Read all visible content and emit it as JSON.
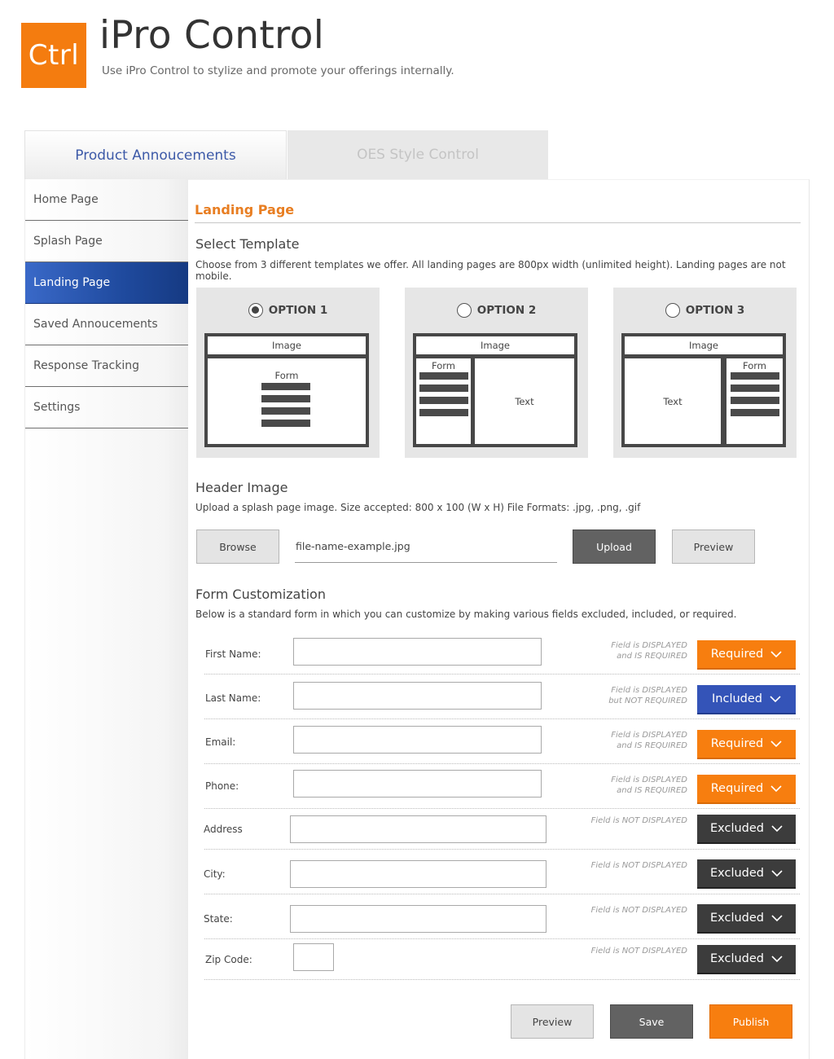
{
  "app": {
    "logo_text": "Ctrl",
    "title": "iPro Control",
    "subtitle": "Use iPro Control to stylize and promote your offerings internally."
  },
  "tabs": [
    {
      "label": "Product Annoucements",
      "active": true
    },
    {
      "label": "OES Style Control",
      "active": false
    }
  ],
  "sidebar": {
    "items": [
      {
        "label": "Home Page"
      },
      {
        "label": "Splash Page"
      },
      {
        "label": "Landing Page",
        "active": true
      },
      {
        "label": "Saved Annoucements"
      },
      {
        "label": "Response Tracking"
      },
      {
        "label": "Settings"
      }
    ]
  },
  "main": {
    "section_title": "Landing Page",
    "template": {
      "heading": "Select Template",
      "description": "Choose from 3 different templates we offer.  All landing pages are 800px width (unlimited height).   Landing pages are not mobile.",
      "options": [
        {
          "label": "OPTION 1",
          "selected": true,
          "image": "Image",
          "form": "Form"
        },
        {
          "label": "OPTION 2",
          "selected": false,
          "image": "Image",
          "form": "Form",
          "text": "Text"
        },
        {
          "label": "OPTION 3",
          "selected": false,
          "image": "Image",
          "form": "Form",
          "text": "Text"
        }
      ]
    },
    "header_image": {
      "heading": "Header Image",
      "description": "Upload a splash page image.  Size accepted: 800 x 100 (W x H)  File Formats: .jpg, .png, .gif",
      "browse_label": "Browse",
      "file_name": "file-name-example.jpg",
      "upload_label": "Upload",
      "preview_label": "Preview"
    },
    "form_custom": {
      "heading": "Form Customization",
      "description": "Below is a standard form in which you can customize by making various fields excluded, included, or required.",
      "fields": [
        {
          "label": "First Name:",
          "note1": "Field is DISPLAYED",
          "note2": "and IS REQUIRED",
          "status": "Required"
        },
        {
          "label": "Last Name:",
          "note1": "Field is DISPLAYED",
          "note2": "but NOT REQUIRED",
          "status": "Included"
        },
        {
          "label": "Email:",
          "note1": "Field is DISPLAYED",
          "note2": "and IS REQUIRED",
          "status": "Required"
        },
        {
          "label": "Phone:",
          "note1": "Field is DISPLAYED",
          "note2": "and IS REQUIRED",
          "status": "Required"
        },
        {
          "label": "Address",
          "note1": "Field is NOT DISPLAYED",
          "note2": "",
          "status": "Excluded"
        },
        {
          "label": "City:",
          "note1": "Field is NOT DISPLAYED",
          "note2": "",
          "status": "Excluded"
        },
        {
          "label": "State:",
          "note1": "Field is NOT DISPLAYED",
          "note2": "",
          "status": "Excluded"
        },
        {
          "label": "Zip Code:",
          "note1": "Field is NOT DISPLAYED",
          "note2": "",
          "status": "Excluded"
        }
      ]
    },
    "actions": {
      "preview_label": "Preview",
      "save_label": "Save",
      "publish_label": "Publish"
    }
  },
  "colors": {
    "brand_orange": "#f77e0f",
    "included_blue": "#3454b8",
    "excluded_dark": "#3c3c3c",
    "nav_active_blue": "#1f4a9e"
  },
  "icons": {
    "status_dropdown": "chevron-down-icon",
    "template_select": "radio-icon"
  }
}
